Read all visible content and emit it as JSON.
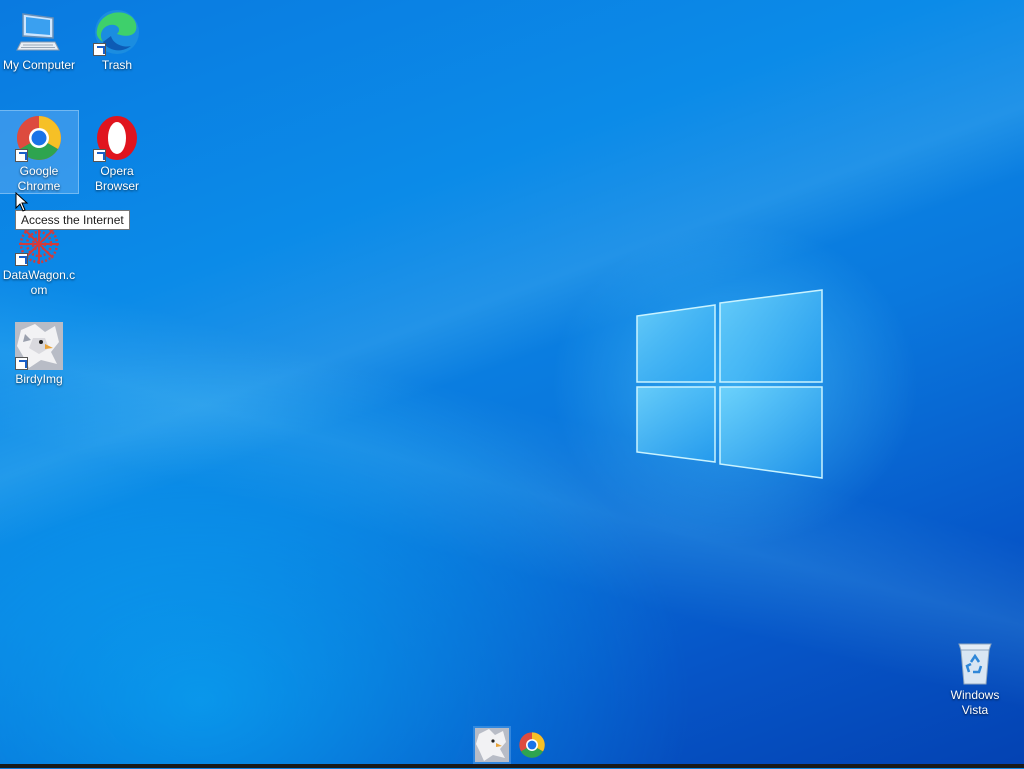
{
  "desktop": {
    "icons": [
      {
        "id": "my-computer",
        "label": "My Computer",
        "icon": "computer-icon"
      },
      {
        "id": "trash",
        "label": "Trash",
        "icon": "edge-icon"
      },
      {
        "id": "google-chrome",
        "label": "Google Chrome",
        "icon": "chrome-icon",
        "selected": true
      },
      {
        "id": "opera-browser",
        "label": "Opera Browser",
        "icon": "opera-icon"
      },
      {
        "id": "datawagon",
        "label": "DataWagon.com",
        "icon": "datawagon-icon"
      },
      {
        "id": "birdyimg",
        "label": "BirdyImg",
        "icon": "birdyimg-icon"
      },
      {
        "id": "windows-vista",
        "label": "Windows Vista",
        "icon": "recycle-bin-icon"
      }
    ],
    "tooltip": "Access the Internet"
  },
  "taskbar": {
    "items": [
      {
        "id": "birdyimg",
        "icon": "birdyimg-icon"
      },
      {
        "id": "chrome",
        "icon": "chrome-icon"
      }
    ]
  },
  "colors": {
    "accent": "#0a78dd",
    "background_dark": "#0442b2",
    "taskbar": "#1a1a1a"
  }
}
